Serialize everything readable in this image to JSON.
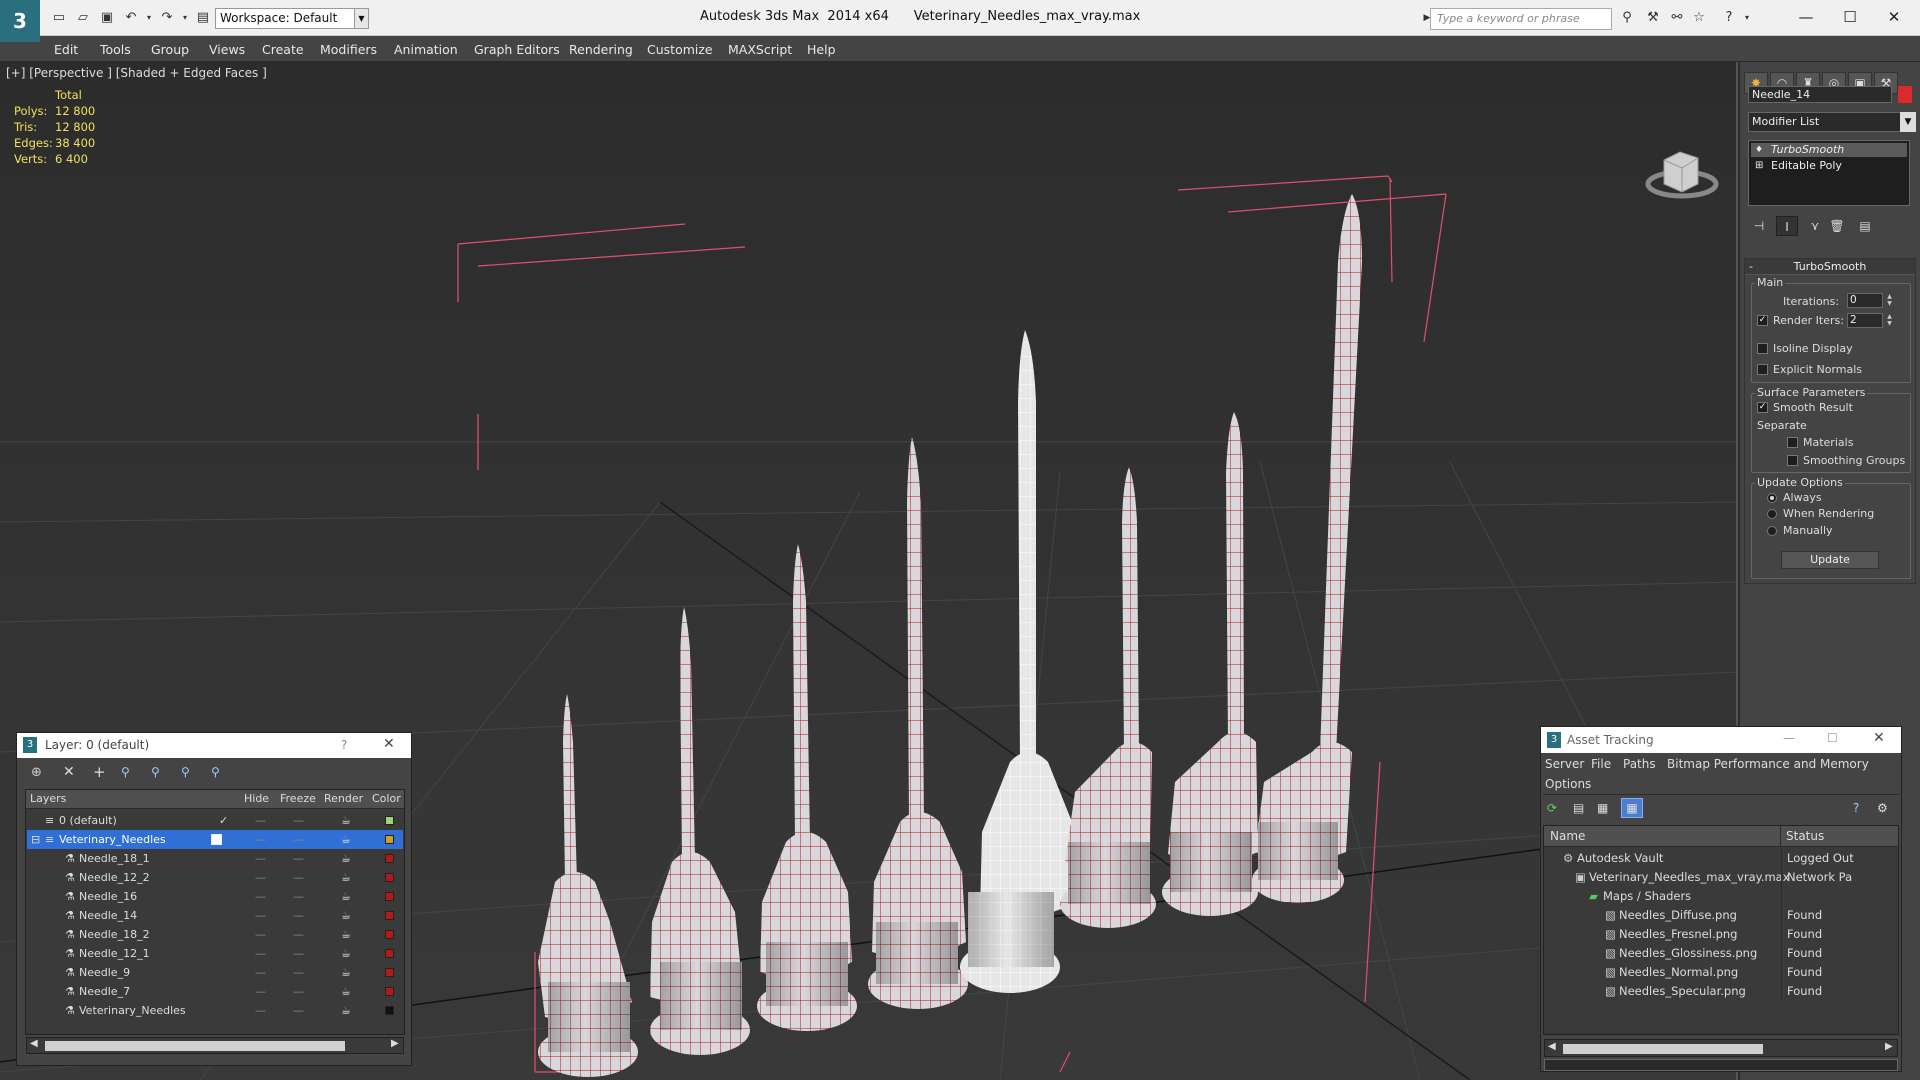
{
  "titlebar": {
    "workspace": "Workspace: Default",
    "app_title": "Autodesk 3ds Max  2014 x64",
    "file_title": "Veterinary_Needles_max_vray.max",
    "search_placeholder": "Type a keyword or phrase"
  },
  "menubar": [
    "Edit",
    "Tools",
    "Group",
    "Views",
    "Create",
    "Modifiers",
    "Animation",
    "Graph Editors",
    "Rendering",
    "Customize",
    "MAXScript",
    "Help"
  ],
  "viewport": {
    "label": "[+] [Perspective ] [Shaded + Edged Faces ]",
    "stats_header": "Total",
    "stats": [
      {
        "label": "Polys:",
        "value": "12 800"
      },
      {
        "label": "Tris:",
        "value": "12 800"
      },
      {
        "label": "Edges:",
        "value": "38 400"
      },
      {
        "label": "Verts:",
        "value": "6 400"
      }
    ]
  },
  "command_panel": {
    "object_name": "Needle_14",
    "object_color": "#d92b2b",
    "modifier_list": "Modifier List",
    "stack": [
      "TurboSmooth",
      "Editable Poly"
    ],
    "turbosmooth": {
      "title": "TurboSmooth",
      "main_label": "Main",
      "iterations_label": "Iterations:",
      "iterations_value": "0",
      "render_iters_label": "Render Iters:",
      "render_iters_value": "2",
      "isoline": "Isoline Display",
      "explicit_normals": "Explicit Normals",
      "surface_params": "Surface Parameters",
      "smooth_result": "Smooth Result",
      "separate": "Separate",
      "materials": "Materials",
      "smoothing_groups": "Smoothing Groups",
      "update_options": "Update Options",
      "always": "Always",
      "when_rendering": "When Rendering",
      "manually": "Manually",
      "update_button": "Update"
    }
  },
  "layers_panel": {
    "title": "Layer: 0 (default)",
    "help": "?",
    "columns": [
      "Layers",
      "Hide",
      "Freeze",
      "Render",
      "Color"
    ],
    "rows": [
      {
        "name": "0 (default)",
        "color": "#9ed37a",
        "check": "✓"
      },
      {
        "name": "Veterinary_Needles",
        "color": "#c9a227"
      },
      {
        "name": "Needle_18_1",
        "color": "#b01a1a"
      },
      {
        "name": "Needle_12_2",
        "color": "#b01a1a"
      },
      {
        "name": "Needle_16",
        "color": "#b01a1a"
      },
      {
        "name": "Needle_14",
        "color": "#b01a1a"
      },
      {
        "name": "Needle_18_2",
        "color": "#b01a1a"
      },
      {
        "name": "Needle_12_1",
        "color": "#b01a1a"
      },
      {
        "name": "Needle_9",
        "color": "#b01a1a"
      },
      {
        "name": "Needle_7",
        "color": "#b01a1a"
      },
      {
        "name": "Veterinary_Needles",
        "color": "#111111"
      }
    ]
  },
  "asset_tracking": {
    "title": "Asset Tracking",
    "menus": [
      "Server",
      "File",
      "Paths",
      "Bitmap Performance and Memory",
      "Options"
    ],
    "columns": [
      "Name",
      "Status"
    ],
    "rows": [
      {
        "name": "Autodesk Vault",
        "status": "Logged Out"
      },
      {
        "name": "Veterinary_Needles_max_vray.max",
        "status": "Network Pa"
      },
      {
        "name": "Maps / Shaders",
        "status": ""
      },
      {
        "name": "Needles_Diffuse.png",
        "status": "Found"
      },
      {
        "name": "Needles_Fresnel.png",
        "status": "Found"
      },
      {
        "name": "Needles_Glossiness.png",
        "status": "Found"
      },
      {
        "name": "Needles_Normal.png",
        "status": "Found"
      },
      {
        "name": "Needles_Specular.png",
        "status": "Found"
      }
    ]
  }
}
